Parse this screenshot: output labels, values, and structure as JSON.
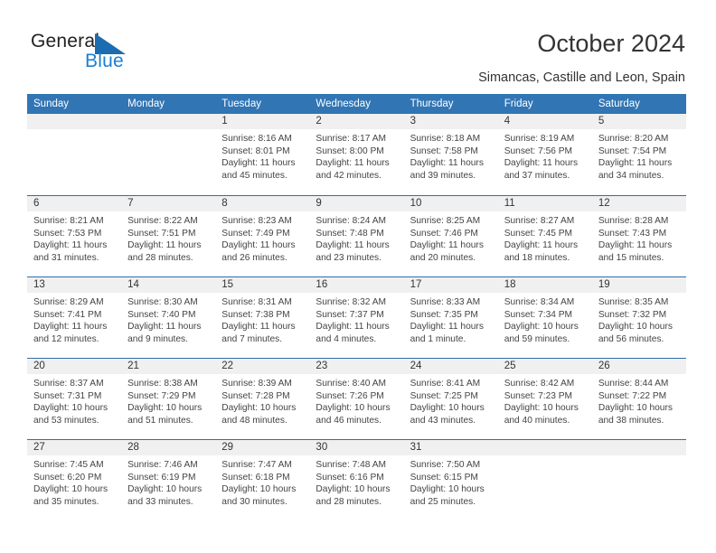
{
  "brand": {
    "name_top": "General",
    "name_bottom": "Blue",
    "triangle_color": "#1b6cb0",
    "blue_color": "#1b7fd4"
  },
  "header": {
    "title": "October 2024",
    "subtitle": "Simancas, Castille and Leon, Spain"
  },
  "theme": {
    "header_blue": "#3175b4",
    "row_rule": "#2f6ea8",
    "daynum_band": "#f0f0f0"
  },
  "weekday_headers": [
    "Sunday",
    "Monday",
    "Tuesday",
    "Wednesday",
    "Thursday",
    "Friday",
    "Saturday"
  ],
  "weeks": [
    [
      {
        "day": "",
        "sunrise": "",
        "sunset": "",
        "daylight": ""
      },
      {
        "day": "",
        "sunrise": "",
        "sunset": "",
        "daylight": ""
      },
      {
        "day": "1",
        "sunrise": "Sunrise: 8:16 AM",
        "sunset": "Sunset: 8:01 PM",
        "daylight": "Daylight: 11 hours and 45 minutes."
      },
      {
        "day": "2",
        "sunrise": "Sunrise: 8:17 AM",
        "sunset": "Sunset: 8:00 PM",
        "daylight": "Daylight: 11 hours and 42 minutes."
      },
      {
        "day": "3",
        "sunrise": "Sunrise: 8:18 AM",
        "sunset": "Sunset: 7:58 PM",
        "daylight": "Daylight: 11 hours and 39 minutes."
      },
      {
        "day": "4",
        "sunrise": "Sunrise: 8:19 AM",
        "sunset": "Sunset: 7:56 PM",
        "daylight": "Daylight: 11 hours and 37 minutes."
      },
      {
        "day": "5",
        "sunrise": "Sunrise: 8:20 AM",
        "sunset": "Sunset: 7:54 PM",
        "daylight": "Daylight: 11 hours and 34 minutes."
      }
    ],
    [
      {
        "day": "6",
        "sunrise": "Sunrise: 8:21 AM",
        "sunset": "Sunset: 7:53 PM",
        "daylight": "Daylight: 11 hours and 31 minutes."
      },
      {
        "day": "7",
        "sunrise": "Sunrise: 8:22 AM",
        "sunset": "Sunset: 7:51 PM",
        "daylight": "Daylight: 11 hours and 28 minutes."
      },
      {
        "day": "8",
        "sunrise": "Sunrise: 8:23 AM",
        "sunset": "Sunset: 7:49 PM",
        "daylight": "Daylight: 11 hours and 26 minutes."
      },
      {
        "day": "9",
        "sunrise": "Sunrise: 8:24 AM",
        "sunset": "Sunset: 7:48 PM",
        "daylight": "Daylight: 11 hours and 23 minutes."
      },
      {
        "day": "10",
        "sunrise": "Sunrise: 8:25 AM",
        "sunset": "Sunset: 7:46 PM",
        "daylight": "Daylight: 11 hours and 20 minutes."
      },
      {
        "day": "11",
        "sunrise": "Sunrise: 8:27 AM",
        "sunset": "Sunset: 7:45 PM",
        "daylight": "Daylight: 11 hours and 18 minutes."
      },
      {
        "day": "12",
        "sunrise": "Sunrise: 8:28 AM",
        "sunset": "Sunset: 7:43 PM",
        "daylight": "Daylight: 11 hours and 15 minutes."
      }
    ],
    [
      {
        "day": "13",
        "sunrise": "Sunrise: 8:29 AM",
        "sunset": "Sunset: 7:41 PM",
        "daylight": "Daylight: 11 hours and 12 minutes."
      },
      {
        "day": "14",
        "sunrise": "Sunrise: 8:30 AM",
        "sunset": "Sunset: 7:40 PM",
        "daylight": "Daylight: 11 hours and 9 minutes."
      },
      {
        "day": "15",
        "sunrise": "Sunrise: 8:31 AM",
        "sunset": "Sunset: 7:38 PM",
        "daylight": "Daylight: 11 hours and 7 minutes."
      },
      {
        "day": "16",
        "sunrise": "Sunrise: 8:32 AM",
        "sunset": "Sunset: 7:37 PM",
        "daylight": "Daylight: 11 hours and 4 minutes."
      },
      {
        "day": "17",
        "sunrise": "Sunrise: 8:33 AM",
        "sunset": "Sunset: 7:35 PM",
        "daylight": "Daylight: 11 hours and 1 minute."
      },
      {
        "day": "18",
        "sunrise": "Sunrise: 8:34 AM",
        "sunset": "Sunset: 7:34 PM",
        "daylight": "Daylight: 10 hours and 59 minutes."
      },
      {
        "day": "19",
        "sunrise": "Sunrise: 8:35 AM",
        "sunset": "Sunset: 7:32 PM",
        "daylight": "Daylight: 10 hours and 56 minutes."
      }
    ],
    [
      {
        "day": "20",
        "sunrise": "Sunrise: 8:37 AM",
        "sunset": "Sunset: 7:31 PM",
        "daylight": "Daylight: 10 hours and 53 minutes."
      },
      {
        "day": "21",
        "sunrise": "Sunrise: 8:38 AM",
        "sunset": "Sunset: 7:29 PM",
        "daylight": "Daylight: 10 hours and 51 minutes."
      },
      {
        "day": "22",
        "sunrise": "Sunrise: 8:39 AM",
        "sunset": "Sunset: 7:28 PM",
        "daylight": "Daylight: 10 hours and 48 minutes."
      },
      {
        "day": "23",
        "sunrise": "Sunrise: 8:40 AM",
        "sunset": "Sunset: 7:26 PM",
        "daylight": "Daylight: 10 hours and 46 minutes."
      },
      {
        "day": "24",
        "sunrise": "Sunrise: 8:41 AM",
        "sunset": "Sunset: 7:25 PM",
        "daylight": "Daylight: 10 hours and 43 minutes."
      },
      {
        "day": "25",
        "sunrise": "Sunrise: 8:42 AM",
        "sunset": "Sunset: 7:23 PM",
        "daylight": "Daylight: 10 hours and 40 minutes."
      },
      {
        "day": "26",
        "sunrise": "Sunrise: 8:44 AM",
        "sunset": "Sunset: 7:22 PM",
        "daylight": "Daylight: 10 hours and 38 minutes."
      }
    ],
    [
      {
        "day": "27",
        "sunrise": "Sunrise: 7:45 AM",
        "sunset": "Sunset: 6:20 PM",
        "daylight": "Daylight: 10 hours and 35 minutes."
      },
      {
        "day": "28",
        "sunrise": "Sunrise: 7:46 AM",
        "sunset": "Sunset: 6:19 PM",
        "daylight": "Daylight: 10 hours and 33 minutes."
      },
      {
        "day": "29",
        "sunrise": "Sunrise: 7:47 AM",
        "sunset": "Sunset: 6:18 PM",
        "daylight": "Daylight: 10 hours and 30 minutes."
      },
      {
        "day": "30",
        "sunrise": "Sunrise: 7:48 AM",
        "sunset": "Sunset: 6:16 PM",
        "daylight": "Daylight: 10 hours and 28 minutes."
      },
      {
        "day": "31",
        "sunrise": "Sunrise: 7:50 AM",
        "sunset": "Sunset: 6:15 PM",
        "daylight": "Daylight: 10 hours and 25 minutes."
      },
      {
        "day": "",
        "sunrise": "",
        "sunset": "",
        "daylight": ""
      },
      {
        "day": "",
        "sunrise": "",
        "sunset": "",
        "daylight": ""
      }
    ]
  ]
}
